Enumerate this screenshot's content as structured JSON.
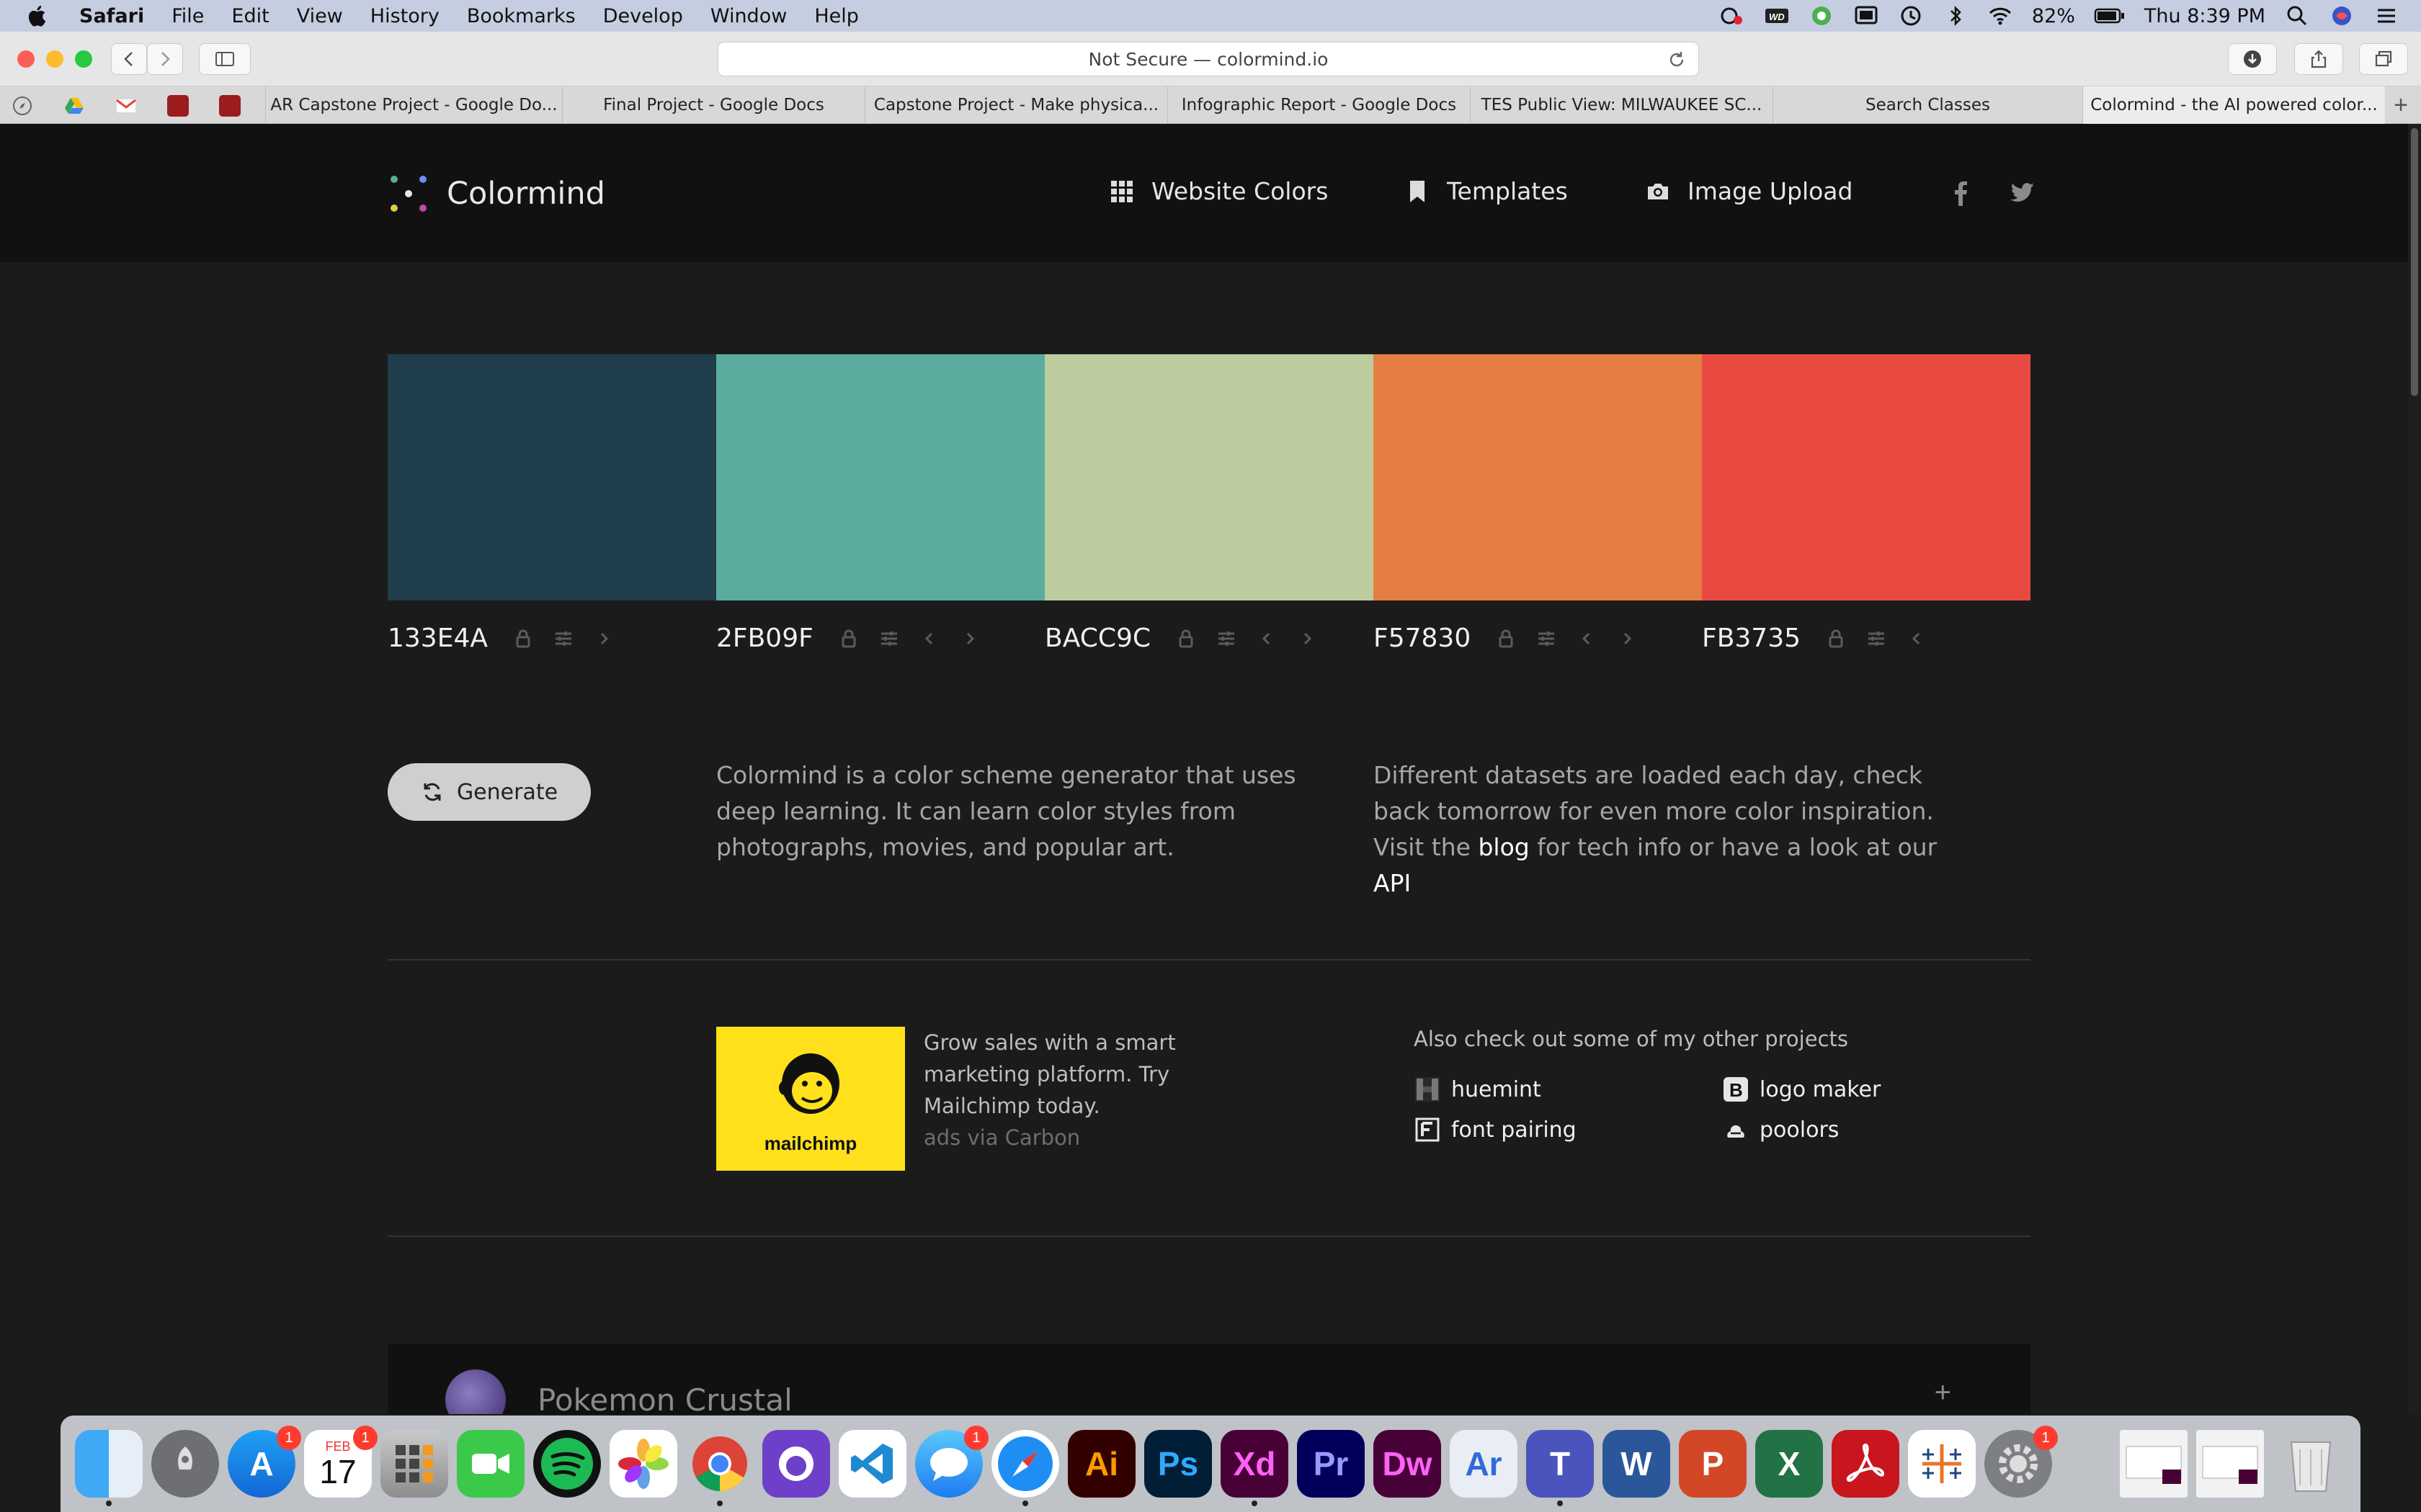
{
  "menubar": {
    "app": "Safari",
    "items": [
      "File",
      "Edit",
      "View",
      "History",
      "Bookmarks",
      "Develop",
      "Window",
      "Help"
    ],
    "battery": "82%",
    "clock": "Thu 8:39 PM"
  },
  "browser": {
    "url": "Not Secure — colormind.io",
    "tabs": [
      {
        "label": "AR Capstone Project - Google Do..."
      },
      {
        "label": "Final Project - Google Docs"
      },
      {
        "label": "Capstone Project - Make physica..."
      },
      {
        "label": "Infographic Report - Google Docs"
      },
      {
        "label": "TES Public View: MILWAUKEE SC..."
      },
      {
        "label": "Search Classes"
      },
      {
        "label": "Colormind - the AI powered color..."
      }
    ]
  },
  "site": {
    "name": "Colormind",
    "nav": [
      {
        "label": "Website Colors",
        "icon": "grid-icon"
      },
      {
        "label": "Templates",
        "icon": "bookmark-icon"
      },
      {
        "label": "Image Upload",
        "icon": "camera-icon"
      }
    ]
  },
  "palette": [
    {
      "hex": "133E4A",
      "color": "#1f3d4a"
    },
    {
      "hex": "2FB09F",
      "color": "#5aad9e"
    },
    {
      "hex": "BACC9C",
      "color": "#bdcc9e"
    },
    {
      "hex": "F57830",
      "color": "#e67d42"
    },
    {
      "hex": "FB3735",
      "color": "#e84a42"
    }
  ],
  "generate_label": "Generate",
  "intro": {
    "left": "Colormind is a color scheme generator that uses deep learning. It can learn color styles from photographs, movies, and popular art.",
    "right_pre": "Different datasets are loaded each day, check back tomorrow for even more color inspiration. Visit the",
    "right_blog": "blog",
    "right_mid": "for tech info or have a look at our",
    "right_api": "API"
  },
  "ad": {
    "brand": "mailchimp",
    "text": "Grow sales with a smart marketing platform. Try Mailchimp today.",
    "via": "ads via Carbon"
  },
  "projects": {
    "title": "Also check out some of my other projects",
    "items": [
      {
        "label": "huemint",
        "icon": "huemint-icon"
      },
      {
        "label": "logo maker",
        "icon": "logo-maker-icon"
      },
      {
        "label": "font pairing",
        "icon": "font-pairing-icon"
      },
      {
        "label": "poolors",
        "icon": "poolors-icon"
      }
    ]
  },
  "card": {
    "title": "Pokemon Crustal",
    "plus": "+"
  },
  "dock": {
    "badges": {
      "app_store": "1",
      "calendar": "1",
      "messages": "1",
      "settings": "1"
    },
    "calendar_month": "FEB",
    "calendar_day": "17"
  }
}
